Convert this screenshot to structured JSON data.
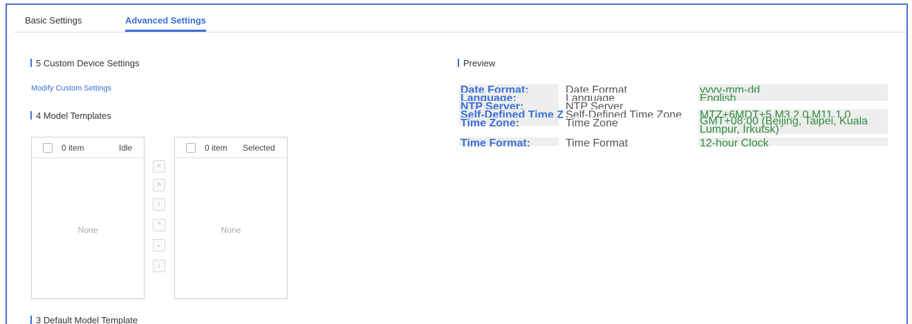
{
  "tabs": [
    {
      "label": "Basic Settings",
      "active": false
    },
    {
      "label": "Advanced Settings",
      "active": true
    }
  ],
  "custom_device": {
    "title": "5 Custom Device Settings",
    "link": "Modify Custom Settings"
  },
  "model_templates": {
    "title": "4 Model Templates",
    "left": {
      "count": "0 item",
      "kind": "Idle",
      "empty": "None"
    },
    "right": {
      "count": "0 item",
      "kind": "Selected",
      "empty": "None"
    },
    "controls": [
      {
        "name": "move-left",
        "glyph": "<"
      },
      {
        "name": "move-right",
        "glyph": ">"
      },
      {
        "name": "move-top",
        "glyph": "↑"
      },
      {
        "name": "move-up",
        "glyph": "^"
      },
      {
        "name": "move-down",
        "glyph": "⌄"
      },
      {
        "name": "move-bottom",
        "glyph": "↓"
      }
    ]
  },
  "default_model": {
    "title": "3 Default Model Template"
  },
  "preview": {
    "title": "Preview",
    "rows": [
      {
        "label": "Date Format:",
        "name": "Date Format",
        "value": "yyyy-mm-dd"
      },
      {
        "label": "Language:",
        "name": "Language",
        "value": "English"
      },
      {
        "label": "NTP Server:",
        "name": "NTP Server",
        "value": ""
      },
      {
        "label": "Self-Defined Time Zone:",
        "name": "Self-Defined Time Zone",
        "value": "MTZ+6MDT+5,M3.2.0,M11.1.0"
      },
      {
        "label": "Time Zone:",
        "name": "Time Zone",
        "value": "GMT+08:00 (Beijing, Taipei, Kuala Lumpur, Irkutsk)"
      },
      {
        "label": "Time Format:",
        "name": "Time Format",
        "value": "12-hour Clock"
      }
    ]
  },
  "colors": {
    "accent": "#3a6fd8",
    "frame_border": "#4a6fc8",
    "value_green": "#2e8b3a"
  }
}
